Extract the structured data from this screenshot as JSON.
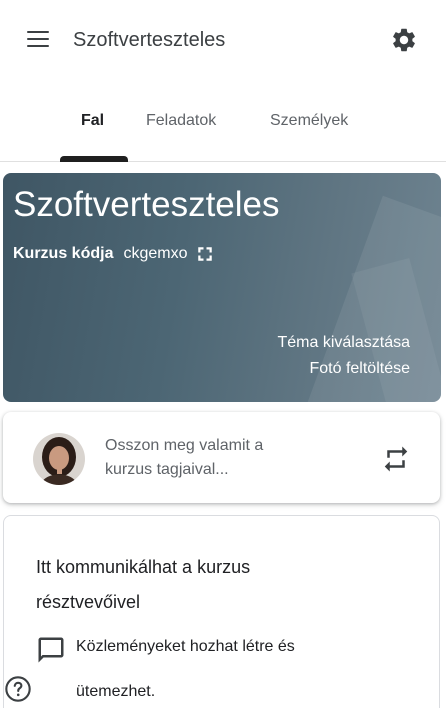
{
  "header": {
    "title": "Szoftverteszteles",
    "menu_icon": "hamburger-menu-icon",
    "settings_icon": "gear-icon"
  },
  "tabs": [
    {
      "label": "Fal",
      "active": true
    },
    {
      "label": "Feladatok",
      "active": false
    },
    {
      "label": "Személyek",
      "active": false
    }
  ],
  "banner": {
    "title": "Szoftverteszteles",
    "code_label": "Kurzus kódja",
    "code_value": "ckgemxo",
    "select_theme": "Téma kiválasztása",
    "upload_photo": "Fotó feltöltése"
  },
  "share": {
    "placeholder_line1": "Osszon meg valamit a",
    "placeholder_line2": "kurzus tagjaival..."
  },
  "info": {
    "heading_line1": "Itt kommunikálhat a kurzus",
    "heading_line2": "résztvevőivel",
    "item_line1": "Közleményeket hozhat létre és",
    "item_line2": "ütemezhet."
  },
  "colors": {
    "banner_bg": "#4c6674",
    "tab_indicator": "#1f1f1f"
  }
}
